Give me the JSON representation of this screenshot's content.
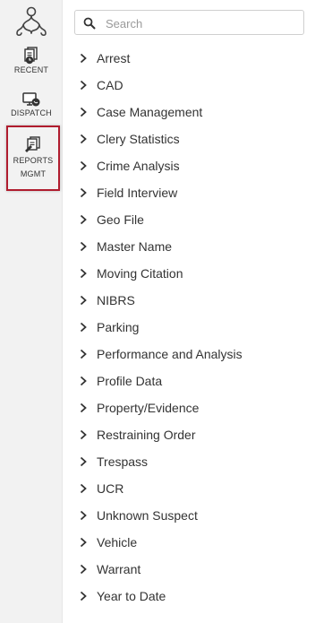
{
  "sidebar": {
    "logo_icon": "network-logo-icon",
    "items": [
      {
        "label": "RECENT",
        "icon": "recent-docs-icon"
      },
      {
        "label": "DISPATCH",
        "icon": "dispatch-icon"
      },
      {
        "label": "REPORTS MGMT",
        "label_line1": "REPORTS",
        "label_line2": "MGMT",
        "icon": "reports-icon",
        "active": true
      }
    ]
  },
  "search": {
    "placeholder": "Search",
    "value": ""
  },
  "report_categories": [
    {
      "label": "Arrest"
    },
    {
      "label": "CAD"
    },
    {
      "label": "Case Management"
    },
    {
      "label": "Clery Statistics"
    },
    {
      "label": "Crime Analysis"
    },
    {
      "label": "Field Interview"
    },
    {
      "label": "Geo File"
    },
    {
      "label": "Master Name"
    },
    {
      "label": "Moving Citation"
    },
    {
      "label": "NIBRS"
    },
    {
      "label": "Parking"
    },
    {
      "label": "Performance and Analysis"
    },
    {
      "label": "Profile Data"
    },
    {
      "label": "Property/Evidence"
    },
    {
      "label": "Restraining Order"
    },
    {
      "label": "Trespass"
    },
    {
      "label": "UCR"
    },
    {
      "label": "Unknown Suspect"
    },
    {
      "label": "Vehicle"
    },
    {
      "label": "Warrant"
    },
    {
      "label": "Year to Date"
    }
  ],
  "colors": {
    "active_border": "#b01c2e",
    "rail_bg": "#f2f2f2",
    "text": "#333333"
  }
}
